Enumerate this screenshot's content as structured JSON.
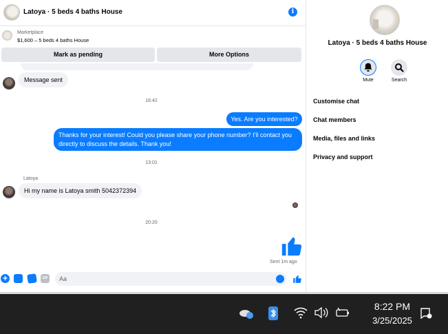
{
  "chat": {
    "title": "Latoya · 5 beds 4 baths House",
    "marketplace_label": "Marketplace",
    "listing": "$1,600 – 5 beds 4 baths House",
    "mark_pending_label": "Mark as pending",
    "more_options_label": "More Options"
  },
  "messages": {
    "msg1": "Message sent",
    "time1": "16:42",
    "out1": "Yes. Are you interested?",
    "out2": "Thanks for your interest! Could you please share your phone number? I'll contact you directly to discuss the details. Thank you!",
    "time2": "13:01",
    "sender": "Latoya",
    "in2": "Hi my name is Latoya smith 5042372394",
    "time3": "20:20",
    "sent_status": "Sent 1m ago"
  },
  "composer": {
    "placeholder": "Aa",
    "gif_label": "GIF"
  },
  "panel": {
    "title": "Latoya · 5 beds 4 baths House",
    "mute_label": "Mute",
    "search_label": "Search",
    "menu": [
      "Customise chat",
      "Chat members",
      "Media, files and links",
      "Privacy and support"
    ]
  },
  "taskbar": {
    "time": "8:22 PM",
    "date": "3/25/2025"
  },
  "colors": {
    "accent": "#0a7cff",
    "bubble_in": "#f0f2f5",
    "taskbar": "#202020"
  }
}
